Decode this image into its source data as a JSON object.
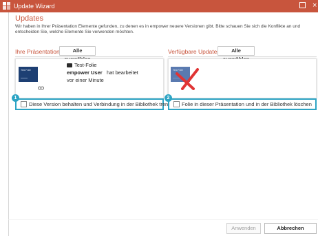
{
  "window": {
    "title": "Update Wizard",
    "accent_color": "#c8553d",
    "highlight_color": "#2da4c4"
  },
  "header": {
    "heading": "Updates",
    "description": "Wir haben in Ihrer Präsentation Elemente gefunden, zu denen es in empower neuere Versionen gibt. Bitte schauen Sie sich die Konflikte an und entscheiden Sie, welche Elemente Sie verwenden möchten."
  },
  "left": {
    "label": "Ihre Präsentation",
    "select_all": "Alle auswählen",
    "slide_name": "Test-Folie",
    "user": "empower User",
    "action": "hat bearbeitet",
    "time": "vor einer Minute",
    "thumb_text": "Test Folie",
    "option_number": "1",
    "option_label": "Diese Version behalten und Verbindung in der Bibliothek trennen"
  },
  "right": {
    "label": "Verfügbare Updates",
    "select_all": "Alle auswählen",
    "thumb_text": "Test Folie",
    "option_number": "2",
    "option_label": "Folie in dieser Präsentation und in der Bibliothek löschen"
  },
  "footer": {
    "apply": "Anwenden",
    "cancel": "Abbrechen"
  }
}
